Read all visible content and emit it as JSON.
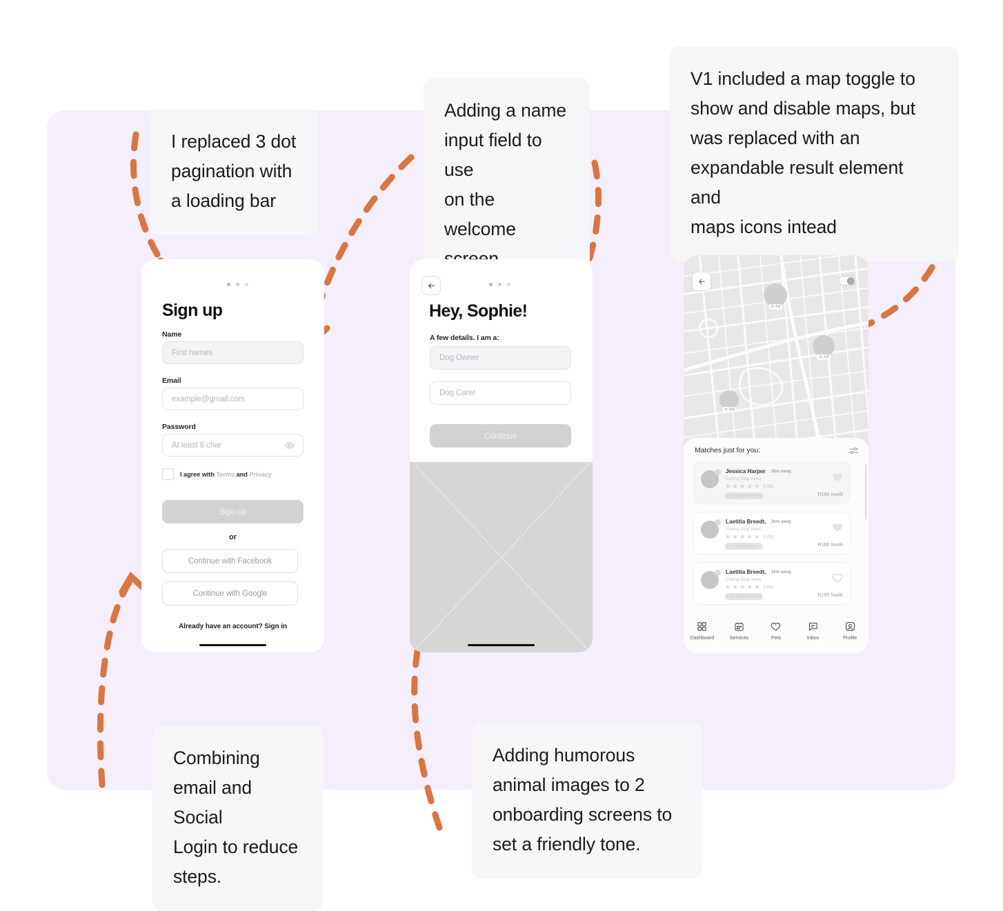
{
  "theme": {
    "backdrop": "#F4EFFB",
    "callout_bg": "#F7F7F9",
    "arrow": "#DB7540",
    "page_bg": "#FFFFFF"
  },
  "callouts": [
    {
      "id": "pagination",
      "text": "I replaced 3 dot\npagination with\na loading bar"
    },
    {
      "id": "name_field",
      "text": "Adding a name\ninput field to use\non the welcome\nscreen"
    },
    {
      "id": "map_toggle",
      "text": "V1 included a map toggle to\nshow and disable maps, but\nwas replaced with an\nexpandable result element and\nmaps icons intead"
    },
    {
      "id": "social",
      "text": "Combining\nemail and Social\nLogin to reduce\nsteps."
    },
    {
      "id": "humor",
      "text": "Adding humorous\nanimal images to 2\nonboarding screens to\nset a friendly tone."
    }
  ],
  "signup_screen": {
    "title": "Sign up",
    "name_label": "Name",
    "name_placeholder": "First names",
    "email_label": "Email",
    "email_placeholder": "example@gmail.com",
    "password_label": "Password",
    "password_placeholder": "At least 8 char",
    "terms_prefix": "I agree with ",
    "terms_link": "Terms",
    "terms_and": " and ",
    "privacy_link": "Privacy",
    "submit_label": "Sign up",
    "or_label": "or",
    "facebook_label": "Continue with Facebook",
    "google_label": "Continue with Google",
    "footer_prefix": "Already have an account? ",
    "footer_link": "Sign in"
  },
  "welcome_screen": {
    "title": "Hey, Sophie!",
    "subtitle": "A few details. I am a:",
    "option_one": "Dog Owner",
    "option_two": "Dog Carer",
    "continue_label": "Continue"
  },
  "map_screen": {
    "sheet_title": "Matches just for you:",
    "pins": [
      {
        "rating": "4.8"
      },
      {
        "rating": "4.8"
      },
      {
        "rating": "4.8"
      }
    ],
    "matches": [
      {
        "name": "Jessica Harper",
        "distance": "2km away",
        "role": "Caring Dog mom",
        "score": "5 (31)",
        "badge": "19 repeat clients",
        "price": "R180 /walk"
      },
      {
        "name": "Laetitia Breedt,",
        "distance": "2km away",
        "role": "Caring Dog mom",
        "score": "5 (31)",
        "badge": "19 repeat clients",
        "price": "R180 /walk"
      },
      {
        "name": "Laetitia Breedt,",
        "distance": "2km away",
        "role": "Caring Dog mom",
        "score": "5 (31)",
        "badge": "19 repeat clients",
        "price": "R180 /walk"
      }
    ],
    "tabs": [
      {
        "label": "Dashboard",
        "icon": "grid-icon"
      },
      {
        "label": "Services",
        "icon": "calendar-icon"
      },
      {
        "label": "Pets",
        "icon": "heart-icon"
      },
      {
        "label": "Inbox",
        "icon": "message-icon"
      },
      {
        "label": "Profile",
        "icon": "person-icon"
      }
    ]
  }
}
